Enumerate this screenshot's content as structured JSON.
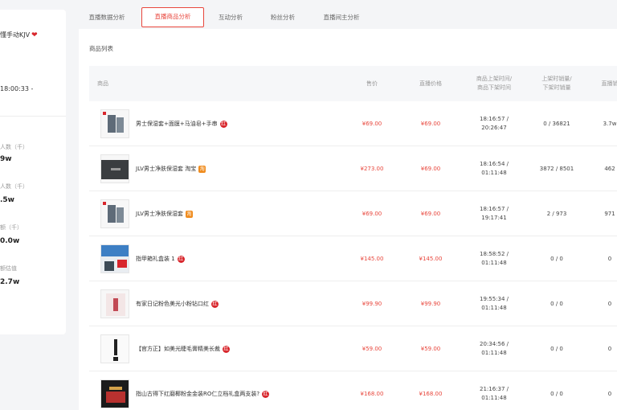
{
  "sidebar": {
    "anchor_name": "懂手动KJV",
    "time_text": "18:00:33 -",
    "stats": [
      {
        "label": "人数（千）",
        "value": "9w"
      },
      {
        "label": "人数（千）",
        "value": ".5w"
      },
      {
        "label": "额（千）",
        "value": "0.0w"
      },
      {
        "label": "额估值",
        "value": "2.7w"
      }
    ]
  },
  "tabs": [
    {
      "label": "直播数据分析",
      "active": false
    },
    {
      "label": "直播商品分析",
      "active": true
    },
    {
      "label": "互动分析",
      "active": false
    },
    {
      "label": "粉丝分析",
      "active": false
    },
    {
      "label": "直播间主分析",
      "active": false
    }
  ],
  "section_title": "商品列表",
  "columns": {
    "product": "商品",
    "price": "售价",
    "live_price": "直播价格",
    "shelf_time_line1": "商品上架时间/",
    "shelf_time_line2": "商品下架时间",
    "shelf_count_line1": "上架时销量/",
    "shelf_count_line2": "下架时销量",
    "live_sales": "直播销"
  },
  "products": [
    {
      "name": "男士保湿套+面膜+马油皂+手串",
      "tag": "红",
      "tag_type": "red",
      "price": "¥69.00",
      "live_price": "¥69.00",
      "shelf_on": "18:16:57 /",
      "shelf_off": "20:26:47",
      "counts": "0 / 36821",
      "live_sales": "3.7w",
      "thumb": "box"
    },
    {
      "name": "JLV男士净肤保湿套 淘宝",
      "tag": "淘",
      "tag_type": "tb",
      "price": "¥273.00",
      "live_price": "¥69.00",
      "shelf_on": "18:16:54 /",
      "shelf_off": "01:11:48",
      "counts": "3872 / 8501",
      "live_sales": "462",
      "thumb": "dark"
    },
    {
      "name": "JLV男士净肤保湿套",
      "tag": "淘",
      "tag_type": "tb",
      "price": "¥69.00",
      "live_price": "¥69.00",
      "shelf_on": "18:16:57 /",
      "shelf_off": "19:17:41",
      "counts": "2 / 973",
      "live_sales": "971",
      "thumb": "box"
    },
    {
      "name": "指甲箱礼盒装 1",
      "tag": "红",
      "tag_type": "red",
      "price": "¥145.00",
      "live_price": "¥145.00",
      "shelf_on": "18:58:52 /",
      "shelf_off": "01:11:48",
      "counts": "0 / 0",
      "live_sales": "0",
      "thumb": "poster"
    },
    {
      "name": "有家日记粉色美光小粉钻口红",
      "tag": "红",
      "tag_type": "red",
      "price": "¥99.90",
      "live_price": "¥99.90",
      "shelf_on": "19:55:34 /",
      "shelf_off": "01:11:48",
      "counts": "0 / 0",
      "live_sales": "0",
      "thumb": "lip"
    },
    {
      "name": "【官方正】如美光睫毛膏精美长裁",
      "tag": "红",
      "tag_type": "red",
      "price": "¥59.00",
      "live_price": "¥59.00",
      "shelf_on": "20:34:56 /",
      "shelf_off": "01:11:48",
      "counts": "0 / 0",
      "live_sales": "0",
      "thumb": "mascara"
    },
    {
      "name": "指山古得下红磨椰粉金金装RO仁立档礼盒两支装?",
      "tag": "红",
      "tag_type": "red",
      "price": "¥168.00",
      "live_price": "¥168.00",
      "shelf_on": "21:16:37 /",
      "shelf_off": "01:11:48",
      "counts": "0 / 0",
      "live_sales": "0",
      "thumb": "giftbox"
    }
  ]
}
